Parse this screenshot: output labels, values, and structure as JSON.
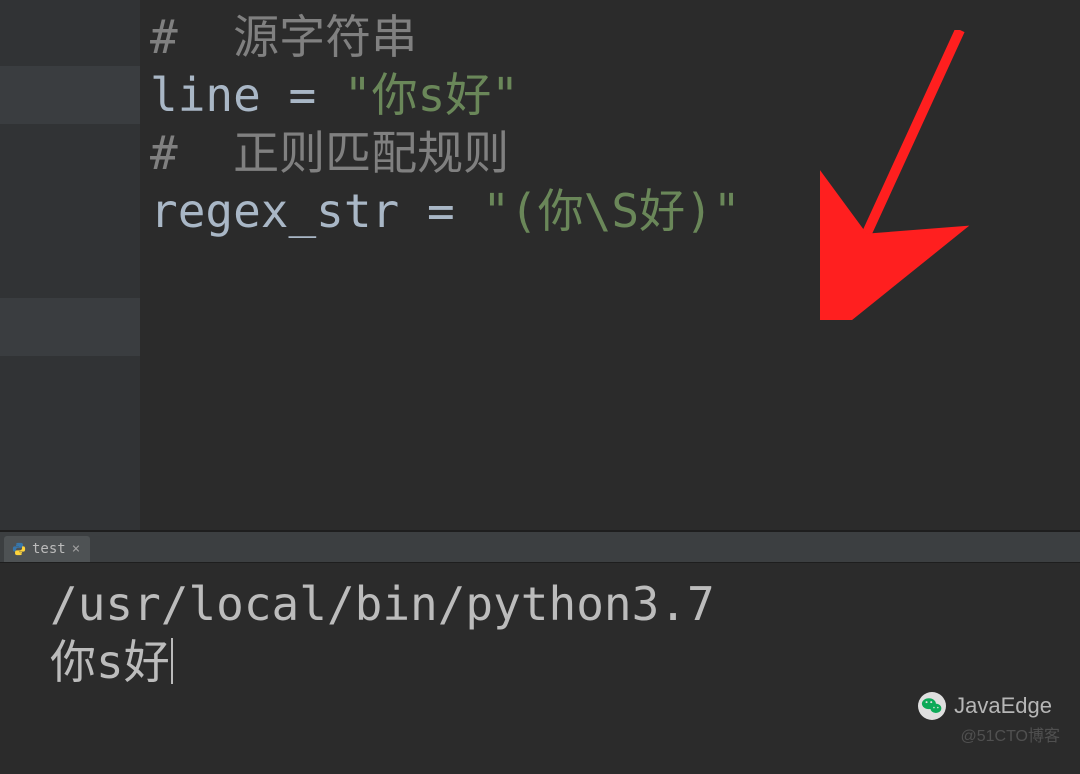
{
  "code": {
    "comment1": "#  源字符串",
    "line_var": "line",
    "eq": " = ",
    "line_str": "\"你s好\"",
    "blank": "",
    "comment2": "#  正则匹配规则",
    "regex_var": "regex_str",
    "regex_str": "\"(你\\S好)\""
  },
  "tab": {
    "name": "test"
  },
  "console": {
    "path": "/usr/local/bin/python3.7",
    "output": "你s好"
  },
  "watermark": {
    "wechat": "JavaEdge",
    "cto": "@51CTO博客"
  }
}
